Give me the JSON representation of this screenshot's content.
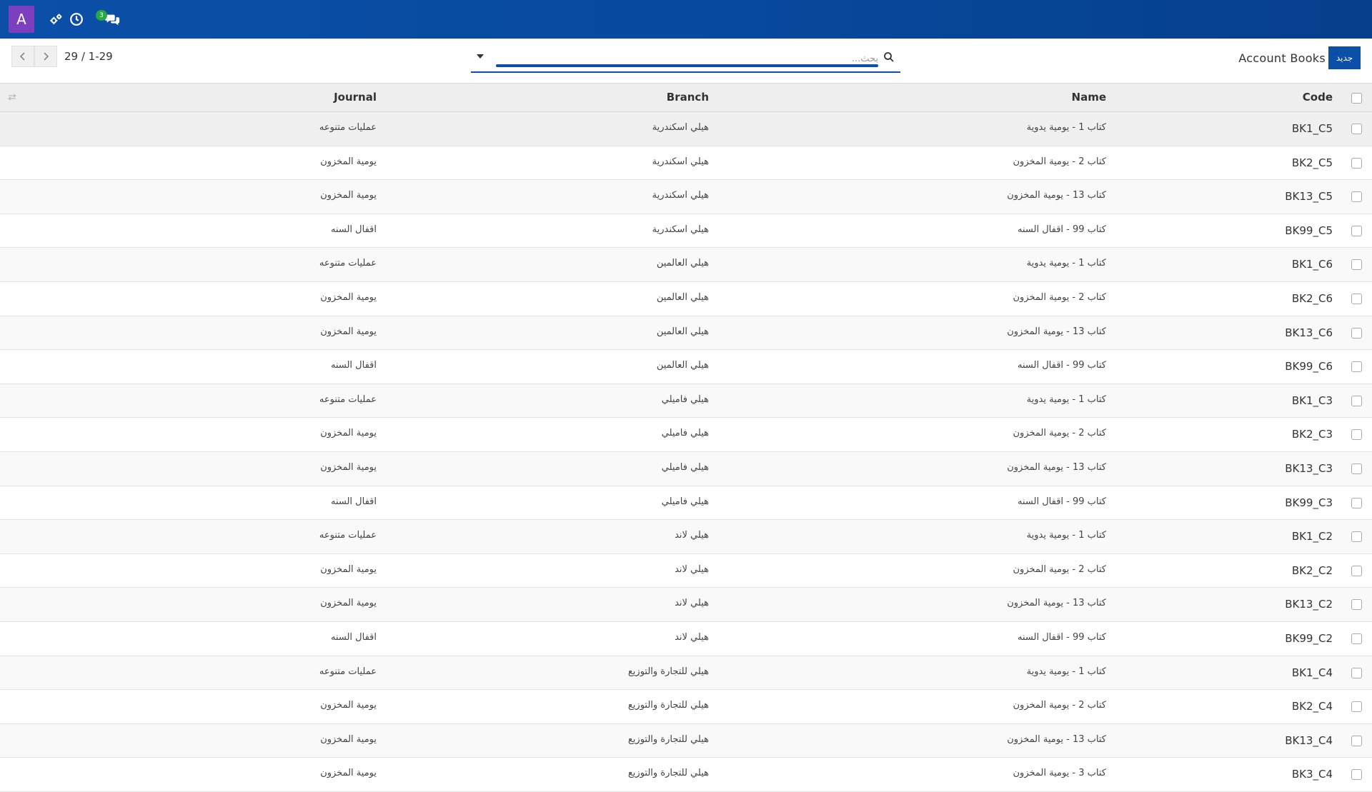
{
  "navbar": {
    "avatar_letter": "A",
    "icons": [
      "settings-icon",
      "clock-icon",
      "chat-icon"
    ],
    "chat_badge": "3"
  },
  "control": {
    "pager": "29 / 1-29",
    "search_placeholder": "بحث...",
    "title": "Account Books",
    "new_label": "جديد"
  },
  "table": {
    "headers": {
      "code": "Code",
      "name": "Name",
      "branch": "Branch",
      "journal": "Journal"
    },
    "rows": [
      {
        "code": "BK1_C5",
        "name": "كتاب 1 - يومية يدوية",
        "branch": "هيلي اسكندرية",
        "journal": "عمليات متنوعه"
      },
      {
        "code": "BK2_C5",
        "name": "كتاب 2 - يومية المخزون",
        "branch": "هيلي اسكندرية",
        "journal": "يومية المخزون"
      },
      {
        "code": "BK13_C5",
        "name": "كتاب 13 - يومية المخزون",
        "branch": "هيلي اسكندرية",
        "journal": "يومية المخزون"
      },
      {
        "code": "BK99_C5",
        "name": "كتاب 99 - اقفال السنه",
        "branch": "هيلي اسكندرية",
        "journal": "اقفال السنه"
      },
      {
        "code": "BK1_C6",
        "name": "كتاب 1 - يومية يدوية",
        "branch": "هيلي العالمين",
        "journal": "عمليات متنوعه"
      },
      {
        "code": "BK2_C6",
        "name": "كتاب 2 - يومية المخزون",
        "branch": "هيلي العالمين",
        "journal": "يومية المخزون"
      },
      {
        "code": "BK13_C6",
        "name": "كتاب 13 - يومية المخزون",
        "branch": "هيلي العالمين",
        "journal": "يومية المخزون"
      },
      {
        "code": "BK99_C6",
        "name": "كتاب 99 - اقفال السنه",
        "branch": "هيلي العالمين",
        "journal": "اقفال السنه"
      },
      {
        "code": "BK1_C3",
        "name": "كتاب 1 - يومية يدوية",
        "branch": "هيلي فاميلي",
        "journal": "عمليات متنوعه"
      },
      {
        "code": "BK2_C3",
        "name": "كتاب 2 - يومية المخزون",
        "branch": "هيلي فاميلي",
        "journal": "يومية المخزون"
      },
      {
        "code": "BK13_C3",
        "name": "كتاب 13 - يومية المخزون",
        "branch": "هيلي فاميلي",
        "journal": "يومية المخزون"
      },
      {
        "code": "BK99_C3",
        "name": "كتاب 99 - اقفال السنه",
        "branch": "هيلي فاميلي",
        "journal": "اقفال السنه"
      },
      {
        "code": "BK1_C2",
        "name": "كتاب 1 - يومية يدوية",
        "branch": "هيلي لاند",
        "journal": "عمليات متنوعه"
      },
      {
        "code": "BK2_C2",
        "name": "كتاب 2 - يومية المخزون",
        "branch": "هيلي لاند",
        "journal": "يومية المخزون"
      },
      {
        "code": "BK13_C2",
        "name": "كتاب 13 - يومية المخزون",
        "branch": "هيلي لاند",
        "journal": "يومية المخزون"
      },
      {
        "code": "BK99_C2",
        "name": "كتاب 99 - اقفال السنه",
        "branch": "هيلي لاند",
        "journal": "اقفال السنه"
      },
      {
        "code": "BK1_C4",
        "name": "كتاب 1 - يومية يدوية",
        "branch": "هيلي للتجارة والتوزيع",
        "journal": "عمليات متنوعه"
      },
      {
        "code": "BK2_C4",
        "name": "كتاب 2 - يومية المخزون",
        "branch": "هيلي للتجارة والتوزيع",
        "journal": "يومية المخزون"
      },
      {
        "code": "BK13_C4",
        "name": "كتاب 13 - يومية المخزون",
        "branch": "هيلي للتجارة والتوزيع",
        "journal": "يومية المخزون"
      },
      {
        "code": "BK3_C4",
        "name": "كتاب 3 - يومية المخزون",
        "branch": "هيلي للتجارة والتوزيع",
        "journal": "يومية المخزون"
      }
    ]
  }
}
